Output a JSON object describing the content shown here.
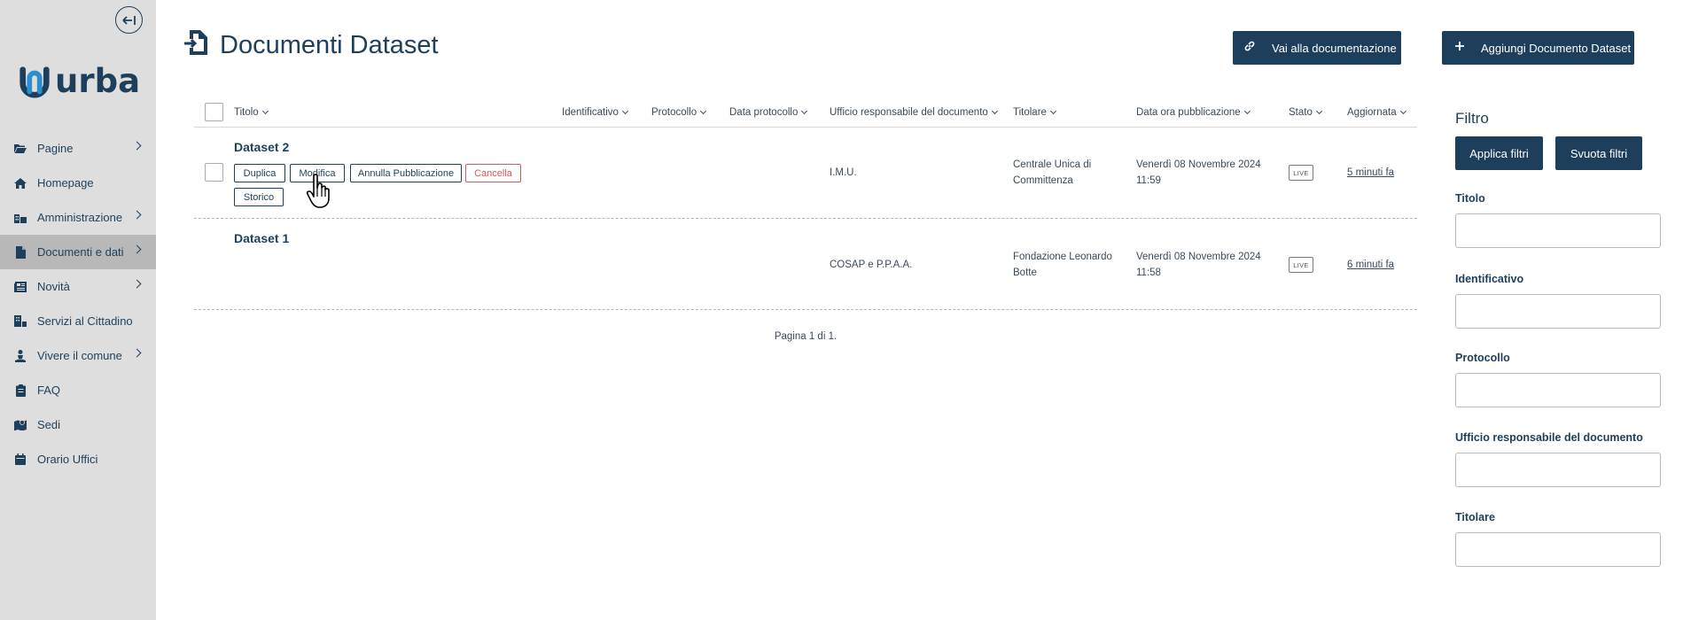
{
  "sidebar": {
    "collapse_icon": "collapse-left-icon",
    "logo_text": "urba",
    "items": [
      {
        "label": "Pagine",
        "icon": "folder-icon",
        "has_children": true,
        "active": false
      },
      {
        "label": "Homepage",
        "icon": "home-icon",
        "has_children": false,
        "active": false
      },
      {
        "label": "Amministrazione",
        "icon": "building-icon",
        "has_children": true,
        "active": false
      },
      {
        "label": "Documenti e dati",
        "icon": "file-icon",
        "has_children": true,
        "active": true
      },
      {
        "label": "Novità",
        "icon": "newspaper-icon",
        "has_children": true,
        "active": false
      },
      {
        "label": "Servizi al Cittadino",
        "icon": "services-icon",
        "has_children": false,
        "active": false
      },
      {
        "label": "Vivere il comune",
        "icon": "person-icon",
        "has_children": true,
        "active": false
      },
      {
        "label": "FAQ",
        "icon": "clipboard-icon",
        "has_children": false,
        "active": false
      },
      {
        "label": "Sedi",
        "icon": "map-icon",
        "has_children": false,
        "active": false
      },
      {
        "label": "Orario Uffici",
        "icon": "calendar-icon",
        "has_children": false,
        "active": false
      }
    ]
  },
  "header": {
    "title": "Documenti Dataset",
    "docs_button": "Vai alla documentazione",
    "add_button": "Aggiungi Documento Dataset"
  },
  "table": {
    "columns": {
      "titolo": "Titolo",
      "identificativo": "Identificativo",
      "protocollo": "Protocollo",
      "data_protocollo": "Data protocollo",
      "ufficio": "Ufficio responsabile del documento",
      "titolare": "Titolare",
      "data_pubblicazione": "Data ora pubblicazione",
      "stato": "Stato",
      "aggiornata": "Aggiornata"
    },
    "rows": [
      {
        "title": "Dataset 2",
        "actions": {
          "duplica": "Duplica",
          "modifica": "Modifica",
          "annulla": "Annulla Pubblicazione",
          "cancella": "Cancella",
          "storico": "Storico"
        },
        "ufficio": "I.M.U.",
        "titolare_line1": "Centrale Unica di",
        "titolare_line2": "Committenza",
        "pub_line1": "Venerdì 08 Novembre 2024",
        "pub_line2": "11:59",
        "stato": "LIVE",
        "updated": "5 minuti fa"
      },
      {
        "title": "Dataset 1",
        "ufficio": "COSAP e P.P.A.A.",
        "titolare_line1": "Fondazione Leonardo",
        "titolare_line2": "Botte",
        "pub_line1": "Venerdì 08 Novembre 2024",
        "pub_line2": "11:58",
        "stato": "LIVE",
        "updated": "6 minuti fa"
      }
    ],
    "pagination": "Pagina 1 di 1."
  },
  "filter": {
    "title": "Filtro",
    "apply": "Applica filtri",
    "clear": "Svuota filtri",
    "fields": {
      "titolo": "Titolo",
      "identificativo": "Identificativo",
      "protocollo": "Protocollo",
      "ufficio": "Ufficio responsabile del documento",
      "titolare": "Titolare"
    }
  },
  "colors": {
    "primary": "#1d3f5c",
    "sidebar_bg": "#dedede",
    "active_bg": "#b8b8b8",
    "danger": "#e05555",
    "logo_accent": "#2a8fd0"
  }
}
